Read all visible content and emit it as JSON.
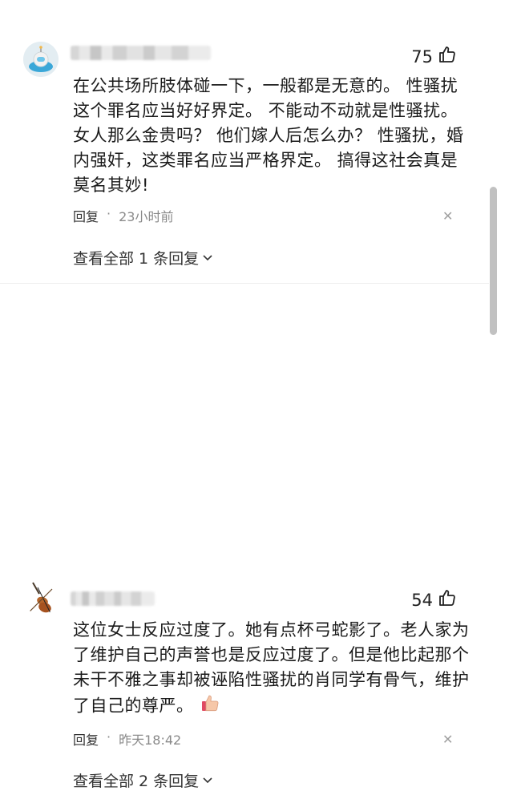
{
  "comments": [
    {
      "avatar_icon": "astronaut-avatar-icon",
      "likes": "75",
      "text": "在公共场所肢体碰一下，一般都是无意的。 性骚扰这个罪名应当好好界定。 不能动不动就是性骚扰。 女人那么金贵吗？ 他们嫁人后怎么办？ 性骚扰，婚内强奸，这类罪名应当严格界定。 搞得这社会真是莫名其妙!",
      "reply_label": "回复",
      "time": "23小时前",
      "view_replies": "查看全部 1 条回复"
    },
    {
      "avatar_icon": "violin-avatar-icon",
      "likes": "54",
      "text": "这位女士反应过度了。她有点杯弓蛇影了。老人家为了维护自己的声誉也是反应过度了。但是他比起那个未干不雅之事却被诬陷性骚扰的肖同学有骨气，维护了自己的尊严。",
      "text_emoji": "thumbs-up-emoji",
      "reply_label": "回复",
      "time": "昨天18:42",
      "view_replies": "查看全部 2 条回复"
    }
  ],
  "icons": {
    "like": "thumbs-up-icon",
    "close": "close-icon",
    "chevron": "chevron-down-icon"
  },
  "colors": {
    "meta_text": "#8a8a8a",
    "scrollbar": "#c1c1c1"
  }
}
